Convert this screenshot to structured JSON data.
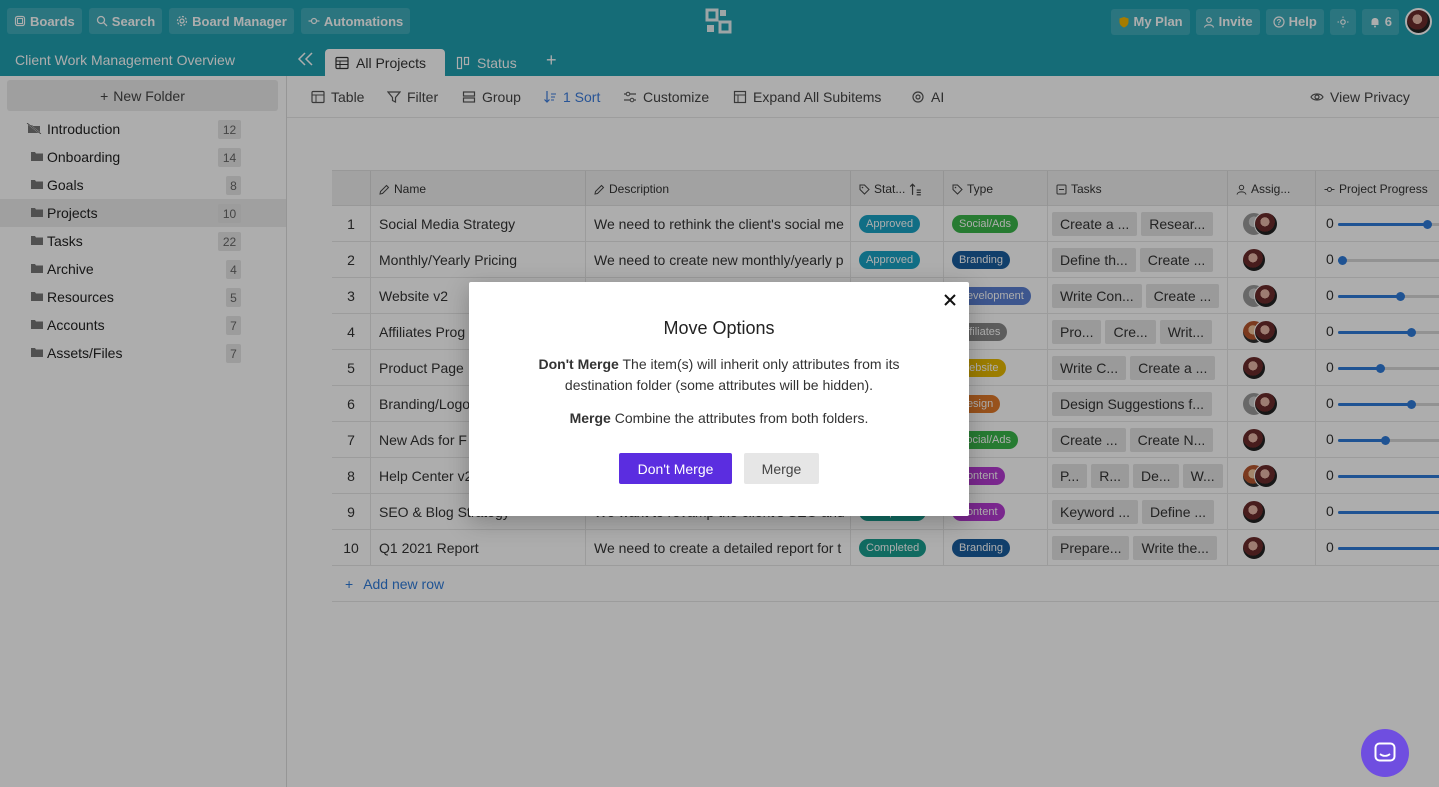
{
  "topbar": {
    "boards": "Boards",
    "search": "Search",
    "board_manager": "Board Manager",
    "automations": "Automations",
    "my_plan": "My Plan",
    "invite": "Invite",
    "help": "Help",
    "notifications_count": "6"
  },
  "board": {
    "title": "Client Work Management Overview",
    "tabs": [
      {
        "label": "All Projects"
      },
      {
        "label": "Status"
      }
    ]
  },
  "sidebar": {
    "new_folder": "New Folder",
    "folders": [
      {
        "label": "Introduction",
        "count": "12"
      },
      {
        "label": "Onboarding",
        "count": "14"
      },
      {
        "label": "Goals",
        "count": "8"
      },
      {
        "label": "Projects",
        "count": "10"
      },
      {
        "label": "Tasks",
        "count": "22"
      },
      {
        "label": "Archive",
        "count": "4"
      },
      {
        "label": "Resources",
        "count": "5"
      },
      {
        "label": "Accounts",
        "count": "7"
      },
      {
        "label": "Assets/Files",
        "count": "7"
      }
    ]
  },
  "toolbar": {
    "table": "Table",
    "filter": "Filter",
    "group": "Group",
    "sort": "1 Sort",
    "customize": "Customize",
    "expand": "Expand All Subitems",
    "ai": "AI",
    "view_privacy": "View Privacy"
  },
  "grid": {
    "headers": [
      "Name",
      "Description",
      "Stat...",
      "Type",
      "Tasks",
      "Assig...",
      "Project Progress"
    ],
    "rows": [
      {
        "num": "1",
        "name": "Social Media Strategy",
        "desc": "We need to rethink the client's social me",
        "status": "Approved",
        "type": "Social/Ads",
        "tasks": [
          "Create a ...",
          "Resear..."
        ],
        "progress": "0",
        "progress_value": 0.81
      },
      {
        "num": "2",
        "name": "Monthly/Yearly Pricing",
        "desc": "We need to create new monthly/yearly p",
        "status": "Approved",
        "type": "Branding",
        "tasks": [
          "Define th...",
          "Create ..."
        ],
        "progress": "0",
        "progress_value": 0.04
      },
      {
        "num": "3",
        "name": "Website v2",
        "desc": "",
        "status": "",
        "type": "Development",
        "tasks": [
          "Write Con...",
          "Create ..."
        ],
        "progress": "0",
        "progress_value": 0.56
      },
      {
        "num": "4",
        "name": "Affiliates Prog",
        "desc": "",
        "status": "",
        "type": "Affiliates",
        "tasks": [
          "Pro...",
          "Cre...",
          "Writ..."
        ],
        "progress": "0",
        "progress_value": 0.66
      },
      {
        "num": "5",
        "name": "Product Page",
        "desc": "",
        "status": "",
        "type": "Website",
        "tasks": [
          "Write C...",
          "Create a ..."
        ],
        "progress": "0",
        "progress_value": 0.38
      },
      {
        "num": "6",
        "name": "Branding/Logo",
        "desc": "",
        "status": "",
        "type": "Design",
        "tasks": [
          "Design Suggestions f..."
        ],
        "progress": "0",
        "progress_value": 0.66
      },
      {
        "num": "7",
        "name": "New Ads for F",
        "desc": "",
        "status": "",
        "type": "Social/Ads",
        "tasks": [
          "Create ...",
          "Create N..."
        ],
        "progress": "0",
        "progress_value": 0.43
      },
      {
        "num": "8",
        "name": "Help Center v2",
        "desc": "",
        "status": "",
        "type": "Content",
        "tasks": [
          "P...",
          "R...",
          "De...",
          "W..."
        ],
        "progress": "0",
        "progress_value": 1.0
      },
      {
        "num": "9",
        "name": "SEO & Blog Strategy",
        "desc": "We want to revamp the client's SEO and",
        "status": "Completed",
        "type": "Content",
        "tasks": [
          "Keyword ...",
          "Define ..."
        ],
        "progress": "0",
        "progress_value": 1.0
      },
      {
        "num": "10",
        "name": "Q1 2021 Report",
        "desc": "We need to create a detailed report for t",
        "status": "Completed",
        "type": "Branding",
        "tasks": [
          "Prepare...",
          "Write the..."
        ],
        "progress": "0",
        "progress_value": 1.0
      }
    ],
    "add_row": "Add new row"
  },
  "modal": {
    "title": "Move Options",
    "dont_merge_bold": "Don't Merge",
    "dont_merge_text": " The item(s) will inherit only attributes from its destination folder (some attributes will be hidden).",
    "merge_bold": "Merge",
    "merge_text": " Combine the attributes from both folders.",
    "btn_dont_merge": "Don't Merge",
    "btn_merge": "Merge"
  },
  "colors": {
    "header": "#1f9fb0",
    "primary_button": "#5b2de0",
    "approved": "#1aa3c5",
    "completed": "#1a9e8f",
    "social_ads": "#3ab54a",
    "branding": "#1a5e9e",
    "development": "#5b7fd1",
    "affiliates": "#8a8a8a",
    "website": "#e6b800",
    "design": "#e07a2a",
    "content": "#b43ad1"
  }
}
